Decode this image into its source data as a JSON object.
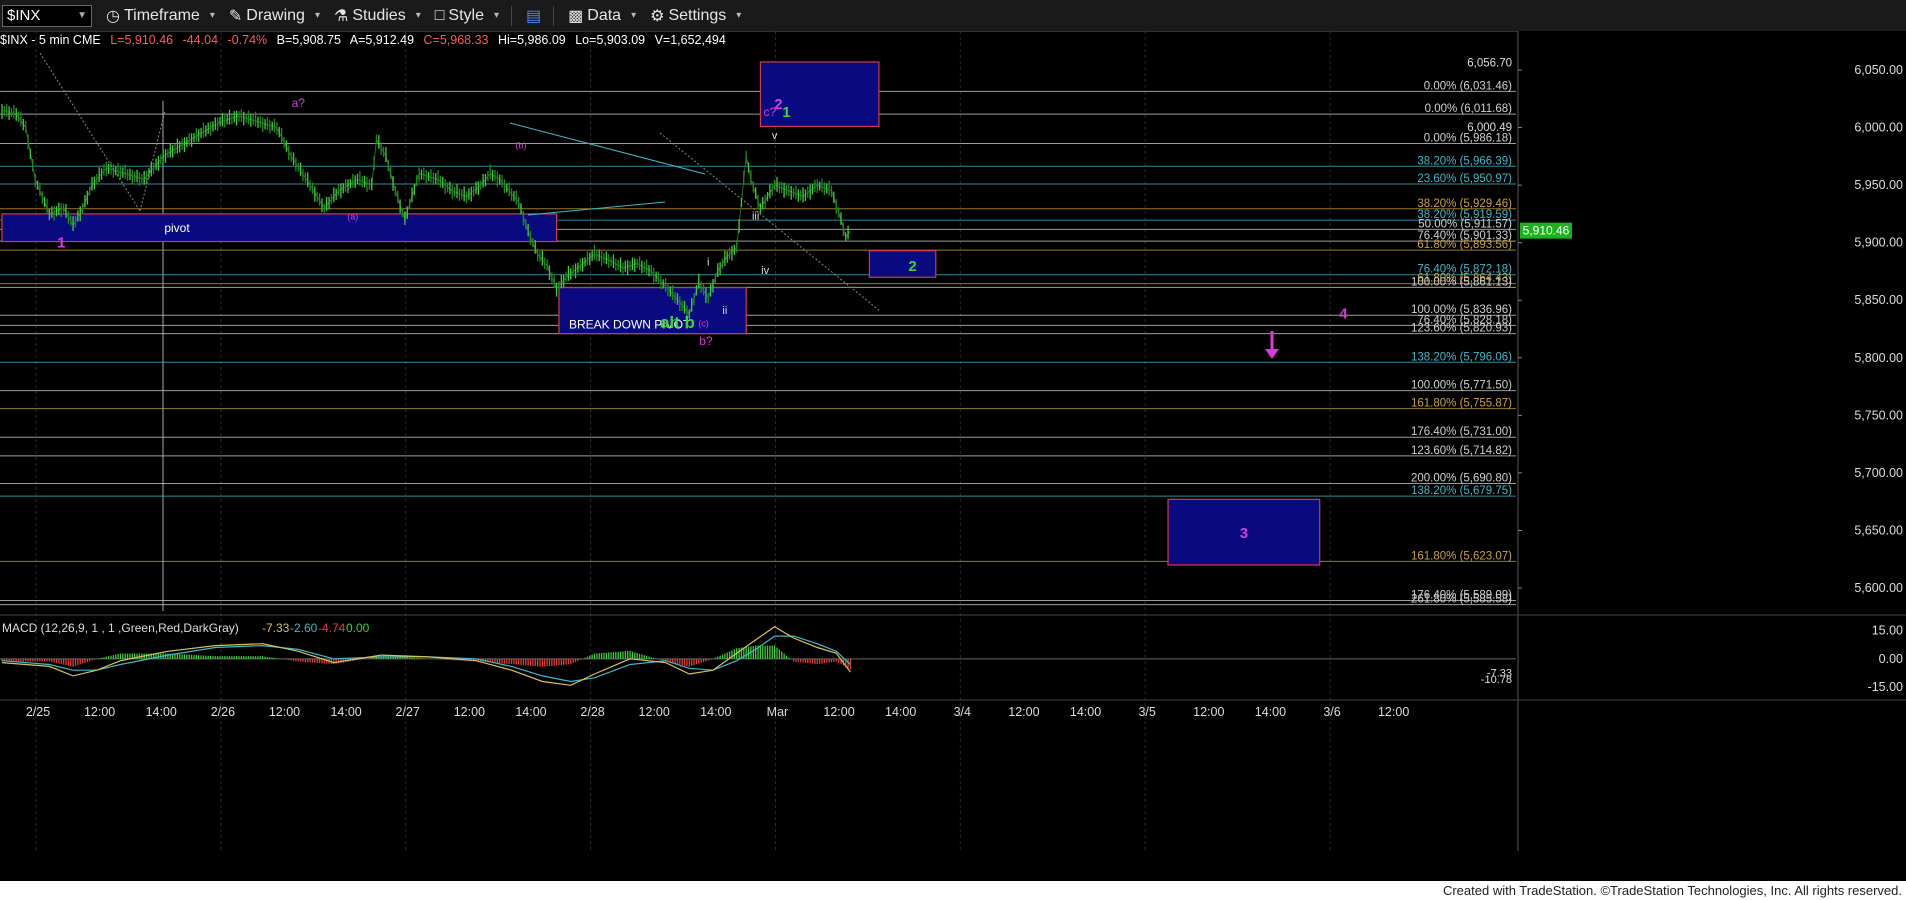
{
  "toolbar": {
    "symbol": "$INX",
    "timeframe": "Timeframe",
    "drawing": "Drawing",
    "studies": "Studies",
    "style": "Style",
    "data": "Data",
    "settings": "Settings"
  },
  "infobar": {
    "symbol": "$INX - 5 min  CME",
    "last": "L=5,910.46",
    "change": "-44.04",
    "change_pct": "-0.74%",
    "bid": "B=5,908.75",
    "ask": "A=5,912.49",
    "close": "C=5,968.33",
    "high": "Hi=5,986.09",
    "low": "Lo=5,903.09",
    "volume": "V=1,652,494"
  },
  "colors": {
    "up": "#3dcc3d",
    "down": "#e23c3c",
    "magenta": "#d93bd9",
    "green_label": "#35d835",
    "box_fill": "#0a0a80",
    "box_border": "#d23a4a",
    "price_tag": "#1bb31b"
  },
  "chart_data": {
    "type": "candlestick",
    "title": "$INX - 5 min",
    "y_range": [
      5580,
      6070
    ],
    "y_ticks": [
      "6,050.00",
      "6,000.00",
      "5,950.00",
      "5,900.00",
      "5,850.00",
      "5,800.00",
      "5,750.00",
      "5,700.00",
      "5,650.00",
      "5,600.00"
    ],
    "y_tick_values": [
      6050,
      6000,
      5950,
      5900,
      5850,
      5800,
      5750,
      5700,
      5650,
      5600
    ],
    "x_ticks": [
      "2/25",
      "12:00",
      "14:00",
      "2/26",
      "12:00",
      "14:00",
      "2/27",
      "12:00",
      "14:00",
      "2/28",
      "12:00",
      "14:00",
      "Mar",
      "12:00",
      "14:00",
      "3/4",
      "12:00",
      "14:00",
      "3/5",
      "12:00",
      "14:00",
      "3/6",
      "12:00"
    ],
    "x_tick_bars": [
      0,
      26,
      52,
      78,
      104,
      130,
      156,
      182,
      208,
      234,
      260,
      286,
      312,
      338,
      364,
      390,
      416,
      442,
      468,
      494,
      520,
      546,
      572
    ],
    "current_price": "5,910.46",
    "current_price_value": 5910.46,
    "price_path": [
      [
        0,
        6015
      ],
      [
        6,
        6012
      ],
      [
        10,
        6000
      ],
      [
        14,
        5955
      ],
      [
        20,
        5925
      ],
      [
        26,
        5930
      ],
      [
        30,
        5915
      ],
      [
        34,
        5930
      ],
      [
        38,
        5950
      ],
      [
        44,
        5965
      ],
      [
        52,
        5960
      ],
      [
        60,
        5955
      ],
      [
        68,
        5975
      ],
      [
        76,
        5985
      ],
      [
        84,
        5995
      ],
      [
        92,
        6005
      ],
      [
        100,
        6010
      ],
      [
        108,
        6005
      ],
      [
        116,
        6000
      ],
      [
        122,
        5975
      ],
      [
        130,
        5950
      ],
      [
        136,
        5930
      ],
      [
        142,
        5945
      ],
      [
        150,
        5955
      ],
      [
        156,
        5950
      ],
      [
        158,
        5990
      ],
      [
        162,
        5975
      ],
      [
        166,
        5945
      ],
      [
        170,
        5920
      ],
      [
        176,
        5960
      ],
      [
        184,
        5955
      ],
      [
        190,
        5945
      ],
      [
        196,
        5940
      ],
      [
        202,
        5950
      ],
      [
        206,
        5960
      ],
      [
        210,
        5955
      ],
      [
        214,
        5945
      ],
      [
        218,
        5935
      ],
      [
        222,
        5910
      ],
      [
        226,
        5890
      ],
      [
        230,
        5880
      ],
      [
        234,
        5860
      ],
      [
        238,
        5870
      ],
      [
        244,
        5880
      ],
      [
        250,
        5890
      ],
      [
        256,
        5885
      ],
      [
        262,
        5878
      ],
      [
        268,
        5882
      ],
      [
        274,
        5875
      ],
      [
        280,
        5862
      ],
      [
        286,
        5848
      ],
      [
        290,
        5838
      ],
      [
        294,
        5865
      ],
      [
        298,
        5852
      ],
      [
        302,
        5875
      ],
      [
        306,
        5888
      ],
      [
        310,
        5896
      ],
      [
        312,
        5935
      ],
      [
        314,
        5975
      ],
      [
        316,
        5955
      ],
      [
        320,
        5930
      ],
      [
        326,
        5950
      ],
      [
        332,
        5945
      ],
      [
        338,
        5940
      ],
      [
        344,
        5950
      ],
      [
        350,
        5945
      ],
      [
        354,
        5920
      ],
      [
        356,
        5905
      ],
      [
        358,
        5910
      ]
    ],
    "horizontal_levels": [
      {
        "label": "0.00% (6,031.46)",
        "value": 6031.46,
        "color": "#cfcfcf"
      },
      {
        "label": "0.00% (6,011.68)",
        "value": 6011.68,
        "color": "#cfcfcf"
      },
      {
        "label": "0.00% (5,986.18)",
        "value": 5986.18,
        "color": "#cfcfcf"
      },
      {
        "label": "38.20% (5,966.39)",
        "value": 5966.39,
        "color": "#3fb8c8"
      },
      {
        "label": "23.60% (5,950.97)",
        "value": 5950.97,
        "color": "#3fb8c8"
      },
      {
        "label": "38.20% (5,929.46)",
        "value": 5929.46,
        "color": "#c8a23a"
      },
      {
        "label": "38.20% (5,919.59)",
        "value": 5919.59,
        "color": "#3fb8c8"
      },
      {
        "label": "50.00% (5,911.57)",
        "value": 5911.57,
        "color": "#cfcfcf"
      },
      {
        "label": "76.40% (5,901.33)",
        "value": 5901.33,
        "color": "#cfcfcf"
      },
      {
        "label": "61.80% (5,893.56)",
        "value": 5893.56,
        "color": "#c8a23a"
      },
      {
        "label": "76.40% (5,872.18)",
        "value": 5872.18,
        "color": "#3fb8c8"
      },
      {
        "label": "61.80% (5,864.43)",
        "value": 5864.43,
        "color": "#c8a23a"
      },
      {
        "label": "100.00% (5,861.13)",
        "value": 5861.13,
        "color": "#cfcfcf"
      },
      {
        "label": "100.00% (5,836.96)",
        "value": 5836.96,
        "color": "#cfcfcf"
      },
      {
        "label": "76.40% (5,828.18)",
        "value": 5828.18,
        "color": "#cfcfcf"
      },
      {
        "label": "123.60% (5,820.93)",
        "value": 5820.93,
        "color": "#cfcfcf"
      },
      {
        "label": "138.20% (5,796.06)",
        "value": 5796.06,
        "color": "#3fb8c8"
      },
      {
        "label": "100.00% (5,771.50)",
        "value": 5771.5,
        "color": "#cfcfcf"
      },
      {
        "label": "161.80% (5,755.87)",
        "value": 5755.87,
        "color": "#c8a23a"
      },
      {
        "label": "176.40% (5,731.00)",
        "value": 5731.0,
        "color": "#cfcfcf"
      },
      {
        "label": "123.60% (5,714.82)",
        "value": 5714.82,
        "color": "#cfcfcf"
      },
      {
        "label": "200.00% (5,690.80)",
        "value": 5690.8,
        "color": "#cfcfcf"
      },
      {
        "label": "138.20% (5,679.75)",
        "value": 5679.75,
        "color": "#3fb8c8"
      },
      {
        "label": "161.80% (5,623.07)",
        "value": 5623.07,
        "color": "#c8a23a"
      },
      {
        "label": "176.40% (5,589.09)",
        "value": 5589.09,
        "color": "#cfcfcf"
      },
      {
        "label": "261.80% (5,585.58)",
        "value": 5585.58,
        "color": "#cfcfcf"
      }
    ],
    "right_axis_tags": [
      {
        "label": "6,056.70",
        "value": 6056.7
      },
      {
        "label": "6,000.49",
        "value": 6000.49
      }
    ],
    "boxes": [
      {
        "name": "pivot",
        "label": "pivot",
        "x1": 0,
        "x2": 234,
        "top": 5925,
        "bottom": 5901
      },
      {
        "name": "breakdown",
        "label": "BREAK DOWN PIVOT",
        "x1": 235,
        "x2": 314,
        "top": 5861,
        "bottom": 5821
      },
      {
        "name": "wave2-top",
        "label": "2",
        "x1": 320,
        "x2": 370,
        "top": 6057,
        "bottom": 6001
      },
      {
        "name": "wave2-target",
        "label": "2",
        "x1": 366,
        "x2": 394,
        "top": 5893,
        "bottom": 5870
      },
      {
        "name": "wave3-target",
        "label": "3",
        "x1": 492,
        "x2": 556,
        "top": 5677,
        "bottom": 5620
      }
    ],
    "wave_labels": [
      {
        "text": "1",
        "bar": 25,
        "value": 5896,
        "color": "#d93bd9",
        "size": 15,
        "bold": true
      },
      {
        "text": "a?",
        "bar": 125,
        "value": 6018,
        "color": "#d93bd9",
        "size": 12,
        "bold": false
      },
      {
        "text": "(a)",
        "bar": 148,
        "value": 5920,
        "color": "#d93bd9",
        "size": 9,
        "bold": false
      },
      {
        "text": "(b)",
        "bar": 219,
        "value": 5982,
        "color": "#d93bd9",
        "size": 9,
        "bold": false
      },
      {
        "text": "(c)",
        "bar": 296,
        "value": 5827,
        "color": "#d93bd9",
        "size": 9,
        "bold": false
      },
      {
        "text": "b?",
        "bar": 297,
        "value": 5811,
        "color": "#d93bd9",
        "size": 12,
        "bold": false
      },
      {
        "text": "alt b",
        "bar": 285,
        "value": 5826,
        "color": "#35d835",
        "size": 17,
        "bold": true
      },
      {
        "text": "i",
        "bar": 298,
        "value": 5880,
        "color": "#dddddd",
        "size": 11,
        "bold": false
      },
      {
        "text": "ii",
        "bar": 305,
        "value": 5838,
        "color": "#dddddd",
        "size": 11,
        "bold": false
      },
      {
        "text": "iii",
        "bar": 318,
        "value": 5920,
        "color": "#dddddd",
        "size": 11,
        "bold": false
      },
      {
        "text": "iv",
        "bar": 322,
        "value": 5873,
        "color": "#dddddd",
        "size": 11,
        "bold": false
      },
      {
        "text": "v",
        "bar": 326,
        "value": 5990,
        "color": "#dddddd",
        "size": 11,
        "bold": false
      },
      {
        "text": "c?",
        "bar": 324,
        "value": 6010,
        "color": "#d93bd9",
        "size": 12,
        "bold": false
      },
      {
        "text": "1",
        "bar": 331,
        "value": 6009,
        "color": "#35d835",
        "size": 15,
        "bold": true
      },
      {
        "text": "4",
        "bar": 566,
        "value": 5834,
        "color": "#d93bd9",
        "size": 15,
        "bold": true
      }
    ],
    "macd": {
      "label": "MACD (12,26,9, 1 , 1 ,Green,Red,DarkGray)",
      "values": [
        "-7.33",
        "-2.60",
        "-4.74",
        "0.00"
      ],
      "value_colors": [
        "#d6c15a",
        "#3fb8c8",
        "#e23c3c",
        "#35d835"
      ],
      "y_range": [
        -17,
        20
      ],
      "y_ticks": [
        "15.00",
        "0.00",
        "-15.00"
      ],
      "y_tick_values": [
        15,
        0,
        -15
      ],
      "tags": [
        "-7.33",
        "-10.78"
      ],
      "tag_values": [
        -7.33,
        -10.78
      ],
      "macd_path": [
        [
          0,
          -2
        ],
        [
          20,
          -4
        ],
        [
          30,
          -9
        ],
        [
          40,
          -6
        ],
        [
          50,
          -1
        ],
        [
          70,
          4
        ],
        [
          90,
          7
        ],
        [
          110,
          8
        ],
        [
          125,
          4
        ],
        [
          140,
          -2
        ],
        [
          160,
          2
        ],
        [
          180,
          1
        ],
        [
          200,
          -1
        ],
        [
          215,
          -6
        ],
        [
          228,
          -12
        ],
        [
          240,
          -14
        ],
        [
          250,
          -8
        ],
        [
          265,
          0
        ],
        [
          280,
          -2
        ],
        [
          290,
          -8
        ],
        [
          300,
          -6
        ],
        [
          310,
          3
        ],
        [
          318,
          10
        ],
        [
          326,
          17
        ],
        [
          334,
          11
        ],
        [
          344,
          6
        ],
        [
          352,
          3
        ],
        [
          358,
          -7
        ]
      ],
      "signal_path": [
        [
          0,
          -1
        ],
        [
          20,
          -3
        ],
        [
          30,
          -6
        ],
        [
          40,
          -6
        ],
        [
          50,
          -3
        ],
        [
          70,
          2
        ],
        [
          90,
          6
        ],
        [
          110,
          7
        ],
        [
          125,
          5
        ],
        [
          140,
          0
        ],
        [
          160,
          1
        ],
        [
          180,
          1
        ],
        [
          200,
          0
        ],
        [
          215,
          -4
        ],
        [
          228,
          -9
        ],
        [
          240,
          -12
        ],
        [
          250,
          -10
        ],
        [
          265,
          -3
        ],
        [
          280,
          -1
        ],
        [
          290,
          -5
        ],
        [
          300,
          -6
        ],
        [
          310,
          -1
        ],
        [
          318,
          5
        ],
        [
          326,
          12
        ],
        [
          334,
          12
        ],
        [
          344,
          8
        ],
        [
          352,
          4
        ],
        [
          358,
          -3
        ]
      ]
    }
  },
  "footer": {
    "text": "Created with TradeStation. ©TradeStation Technologies, Inc. All rights reserved."
  }
}
